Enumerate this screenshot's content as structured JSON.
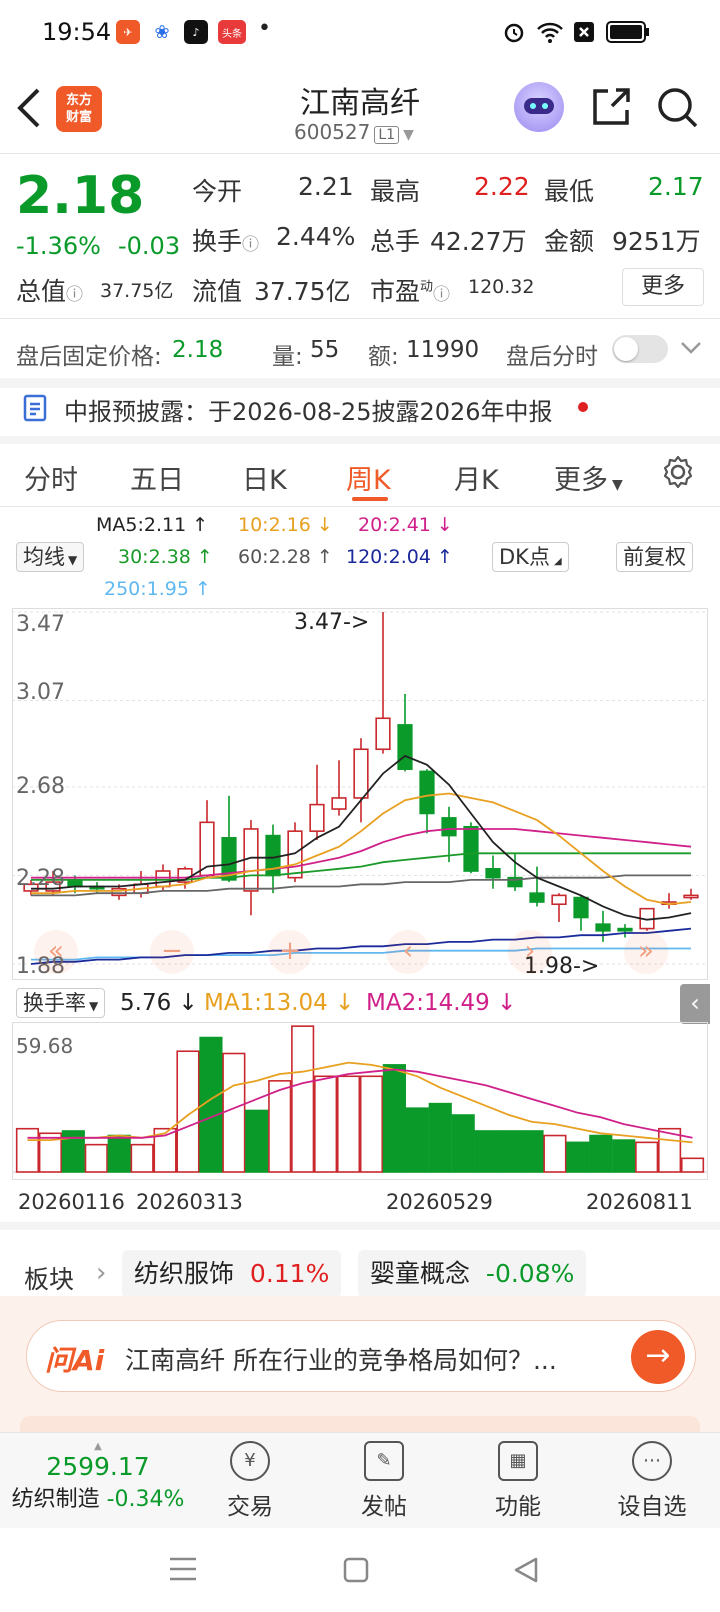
{
  "status_bar": {
    "time": "19:54",
    "app_icons": [
      "feishu-icon",
      "baidu-icon",
      "tiktok-icon",
      "toutiao-icon"
    ],
    "toutiao_label": "头条",
    "dot": "•",
    "icons": [
      "alarm-icon",
      "wifi-icon",
      "battery-icon"
    ]
  },
  "header": {
    "logo_line1": "东方",
    "logo_line2": "财富",
    "stock_name": "江南高纤",
    "stock_code": "600527",
    "level_badge": "L1"
  },
  "quote": {
    "price": "2.18",
    "change_pct": "-1.36%",
    "change_amt": "-0.03",
    "open_label": "今开",
    "open_value": "2.21",
    "high_label": "最高",
    "high_value": "2.22",
    "low_label": "最低",
    "low_value": "2.17",
    "turnover_label": "换手",
    "turnover_value": "2.44%",
    "volume_label": "总手",
    "volume_value": "42.27万",
    "amount_label": "金额",
    "amount_value": "9251万",
    "mktcap_label": "总值",
    "mktcap_value": "37.75亿",
    "float_label": "流值",
    "float_value": "37.75亿",
    "pe_label": "市盈",
    "pe_sup": "动",
    "pe_value": "120.32",
    "more_button": "更多"
  },
  "after_hours": {
    "price_label": "盘后固定价格:",
    "price_value": "2.18",
    "vol_label": "量:",
    "vol_value": "55",
    "amt_label": "额:",
    "amt_value": "11990",
    "timeline_label": "盘后分时"
  },
  "notice": {
    "text": "中报预披露：于2026-08-25披露2026年中报"
  },
  "tabs": [
    {
      "label": "分时"
    },
    {
      "label": "五日"
    },
    {
      "label": "日K"
    },
    {
      "label": "周K",
      "active": true
    },
    {
      "label": "月K"
    },
    {
      "label": "更多"
    }
  ],
  "ma_legend": {
    "selector": "均线",
    "ma5": "MA5:2.11 ↑",
    "ma10": "10:2.16 ↓",
    "ma20": "20:2.41 ↓",
    "ma30": "30:2.38 ↑",
    "ma60": "60:2.28 ↑",
    "ma120": "120:2.04 ↑",
    "ma250": "250:1.95 ↑",
    "dk_button": "DK点",
    "adjust_button": "前复权"
  },
  "colors": {
    "up": "#c8282d",
    "down": "#0a9a2a",
    "ma5": "#222222",
    "ma10": "#e8a020",
    "ma20": "#d0208a",
    "ma30": "#1a9a28",
    "ma60": "#666666",
    "ma120": "#1a2a9a",
    "ma250": "#60b8f0",
    "accent": "#f05a28"
  },
  "chart_data": [
    {
      "type": "candlestick",
      "title": "周K",
      "y_ticks": [
        "3.47",
        "3.07",
        "2.68",
        "2.28",
        "1.88"
      ],
      "ylim": [
        1.88,
        3.47
      ],
      "max_label": "3.47->",
      "min_label": "1.98->",
      "candles": [
        {
          "o": 2.21,
          "c": 2.24,
          "h": 2.26,
          "l": 2.19
        },
        {
          "o": 2.21,
          "c": 2.25,
          "h": 2.3,
          "l": 2.19
        },
        {
          "o": 2.26,
          "c": 2.23,
          "h": 2.28,
          "l": 2.2
        },
        {
          "o": 2.23,
          "c": 2.22,
          "h": 2.25,
          "l": 2.2
        },
        {
          "o": 2.19,
          "c": 2.22,
          "h": 2.24,
          "l": 2.17
        },
        {
          "o": 2.2,
          "c": 2.24,
          "h": 2.3,
          "l": 2.18
        },
        {
          "o": 2.23,
          "c": 2.3,
          "h": 2.33,
          "l": 2.21
        },
        {
          "o": 2.25,
          "c": 2.31,
          "h": 2.32,
          "l": 2.22
        },
        {
          "o": 2.28,
          "c": 2.52,
          "h": 2.62,
          "l": 2.27
        },
        {
          "o": 2.45,
          "c": 2.26,
          "h": 2.64,
          "l": 2.25
        },
        {
          "o": 2.21,
          "c": 2.49,
          "h": 2.53,
          "l": 2.1
        },
        {
          "o": 2.46,
          "c": 2.28,
          "h": 2.51,
          "l": 2.2
        },
        {
          "o": 2.27,
          "c": 2.48,
          "h": 2.52,
          "l": 2.25
        },
        {
          "o": 2.48,
          "c": 2.6,
          "h": 2.78,
          "l": 2.44
        },
        {
          "o": 2.58,
          "c": 2.63,
          "h": 2.8,
          "l": 2.55
        },
        {
          "o": 2.63,
          "c": 2.85,
          "h": 2.9,
          "l": 2.52
        },
        {
          "o": 2.85,
          "c": 2.99,
          "h": 3.47,
          "l": 2.83
        },
        {
          "o": 2.96,
          "c": 2.76,
          "h": 3.1,
          "l": 2.75
        },
        {
          "o": 2.75,
          "c": 2.56,
          "h": 2.76,
          "l": 2.47
        },
        {
          "o": 2.54,
          "c": 2.46,
          "h": 2.59,
          "l": 2.34
        },
        {
          "o": 2.5,
          "c": 2.3,
          "h": 2.52,
          "l": 2.29
        },
        {
          "o": 2.31,
          "c": 2.27,
          "h": 2.37,
          "l": 2.22
        },
        {
          "o": 2.27,
          "c": 2.23,
          "h": 2.38,
          "l": 2.21
        },
        {
          "o": 2.2,
          "c": 2.16,
          "h": 2.32,
          "l": 2.14
        },
        {
          "o": 2.15,
          "c": 2.19,
          "h": 2.2,
          "l": 2.07
        },
        {
          "o": 2.18,
          "c": 2.09,
          "h": 2.19,
          "l": 2.03
        },
        {
          "o": 2.06,
          "c": 2.03,
          "h": 2.12,
          "l": 1.98
        },
        {
          "o": 2.04,
          "c": 2.03,
          "h": 2.06,
          "l": 2.0
        },
        {
          "o": 2.04,
          "c": 2.13,
          "h": 2.13,
          "l": 2.03
        },
        {
          "o": 2.15,
          "c": 2.16,
          "h": 2.2,
          "l": 2.13
        },
        {
          "o": 2.18,
          "c": 2.19,
          "h": 2.22,
          "l": 2.17
        }
      ],
      "ma5": [
        2.22,
        2.22,
        2.23,
        2.23,
        2.23,
        2.24,
        2.25,
        2.26,
        2.32,
        2.33,
        2.36,
        2.36,
        2.38,
        2.45,
        2.5,
        2.62,
        2.74,
        2.82,
        2.78,
        2.69,
        2.56,
        2.43,
        2.34,
        2.27,
        2.23,
        2.19,
        2.14,
        2.1,
        2.08,
        2.09,
        2.11
      ],
      "ma10": [
        2.2,
        2.2,
        2.21,
        2.21,
        2.21,
        2.22,
        2.23,
        2.24,
        2.27,
        2.28,
        2.3,
        2.31,
        2.33,
        2.37,
        2.41,
        2.48,
        2.56,
        2.62,
        2.64,
        2.65,
        2.63,
        2.61,
        2.57,
        2.53,
        2.46,
        2.38,
        2.3,
        2.23,
        2.17,
        2.15,
        2.16
      ],
      "ma20": [
        2.27,
        2.27,
        2.27,
        2.27,
        2.27,
        2.27,
        2.27,
        2.27,
        2.28,
        2.29,
        2.3,
        2.31,
        2.32,
        2.34,
        2.36,
        2.39,
        2.43,
        2.46,
        2.48,
        2.49,
        2.49,
        2.49,
        2.49,
        2.48,
        2.47,
        2.46,
        2.45,
        2.44,
        2.43,
        2.42,
        2.41
      ],
      "ma30": [
        2.26,
        2.26,
        2.26,
        2.26,
        2.26,
        2.26,
        2.26,
        2.26,
        2.27,
        2.27,
        2.28,
        2.28,
        2.29,
        2.3,
        2.31,
        2.32,
        2.34,
        2.35,
        2.36,
        2.37,
        2.38,
        2.38,
        2.38,
        2.38,
        2.38,
        2.38,
        2.38,
        2.38,
        2.38,
        2.38,
        2.38
      ],
      "ma60": [
        2.19,
        2.19,
        2.19,
        2.2,
        2.2,
        2.2,
        2.21,
        2.21,
        2.21,
        2.22,
        2.22,
        2.22,
        2.23,
        2.23,
        2.23,
        2.24,
        2.24,
        2.25,
        2.25,
        2.25,
        2.26,
        2.26,
        2.26,
        2.27,
        2.27,
        2.27,
        2.27,
        2.28,
        2.28,
        2.28,
        2.28
      ],
      "ma120": [
        1.88,
        1.89,
        1.89,
        1.9,
        1.9,
        1.91,
        1.91,
        1.92,
        1.92,
        1.93,
        1.93,
        1.94,
        1.94,
        1.95,
        1.95,
        1.96,
        1.96,
        1.97,
        1.97,
        1.98,
        1.98,
        1.99,
        1.99,
        2.0,
        2.0,
        2.01,
        2.01,
        2.02,
        2.02,
        2.03,
        2.04
      ],
      "ma250": [
        1.9,
        1.9,
        1.9,
        1.91,
        1.91,
        1.91,
        1.91,
        1.92,
        1.92,
        1.92,
        1.92,
        1.92,
        1.93,
        1.93,
        1.93,
        1.93,
        1.93,
        1.94,
        1.94,
        1.94,
        1.94,
        1.94,
        1.94,
        1.95,
        1.95,
        1.95,
        1.95,
        1.95,
        1.95,
        1.95,
        1.95
      ]
    },
    {
      "type": "bar",
      "title": "换手率",
      "selector_label": "换手率",
      "current_value": "5.76 ↓",
      "ma1_label": "MA1:13.04 ↓",
      "ma2_label": "MA2:14.49 ↓",
      "y_max_label": "59.68",
      "ylim": [
        0,
        59.68
      ],
      "x_labels": [
        "20260116",
        "20260313",
        "20260529",
        "20260811"
      ],
      "values": [
        19,
        17,
        18,
        12,
        16,
        12,
        19,
        53,
        59,
        52,
        27,
        40,
        64,
        42,
        42,
        42,
        47,
        28,
        30,
        25,
        18,
        18,
        18,
        16,
        13,
        16,
        14,
        13,
        19,
        6
      ],
      "up": [
        true,
        true,
        false,
        true,
        false,
        true,
        true,
        true,
        false,
        true,
        false,
        true,
        true,
        true,
        true,
        true,
        false,
        false,
        false,
        false,
        false,
        false,
        false,
        true,
        false,
        false,
        false,
        true,
        true,
        true
      ],
      "ma1": [
        14,
        14,
        15,
        15,
        16,
        15,
        17,
        25,
        32,
        38,
        40,
        43,
        44,
        46,
        48,
        47,
        45,
        42,
        37,
        33,
        29,
        25,
        22,
        21,
        19,
        17,
        16,
        15,
        14,
        13
      ],
      "ma2": [
        15,
        15,
        15,
        15,
        15,
        15,
        16,
        20,
        24,
        28,
        32,
        36,
        39,
        41,
        43,
        44,
        45,
        44,
        42,
        40,
        38,
        35,
        32,
        29,
        26,
        24,
        21,
        19,
        17,
        15
      ]
    }
  ],
  "sector": {
    "label": "板块",
    "items": [
      {
        "name": "纺织服饰",
        "pct": "0.11%"
      },
      {
        "name": "婴童概念",
        "pct": "-0.08%"
      }
    ]
  },
  "ai": {
    "logo": "问Ai",
    "question": "江南高纤 所在行业的竞争格局如何？..."
  },
  "bottom_bar": {
    "index_value": "2599.17",
    "index_name": "纺织制造",
    "index_pct": "-0.34%",
    "items": [
      {
        "label": "交易",
        "icon": "trade-icon"
      },
      {
        "label": "发帖",
        "icon": "post-icon"
      },
      {
        "label": "功能",
        "icon": "grid-icon"
      },
      {
        "label": "设自选",
        "icon": "more-icon"
      }
    ]
  }
}
